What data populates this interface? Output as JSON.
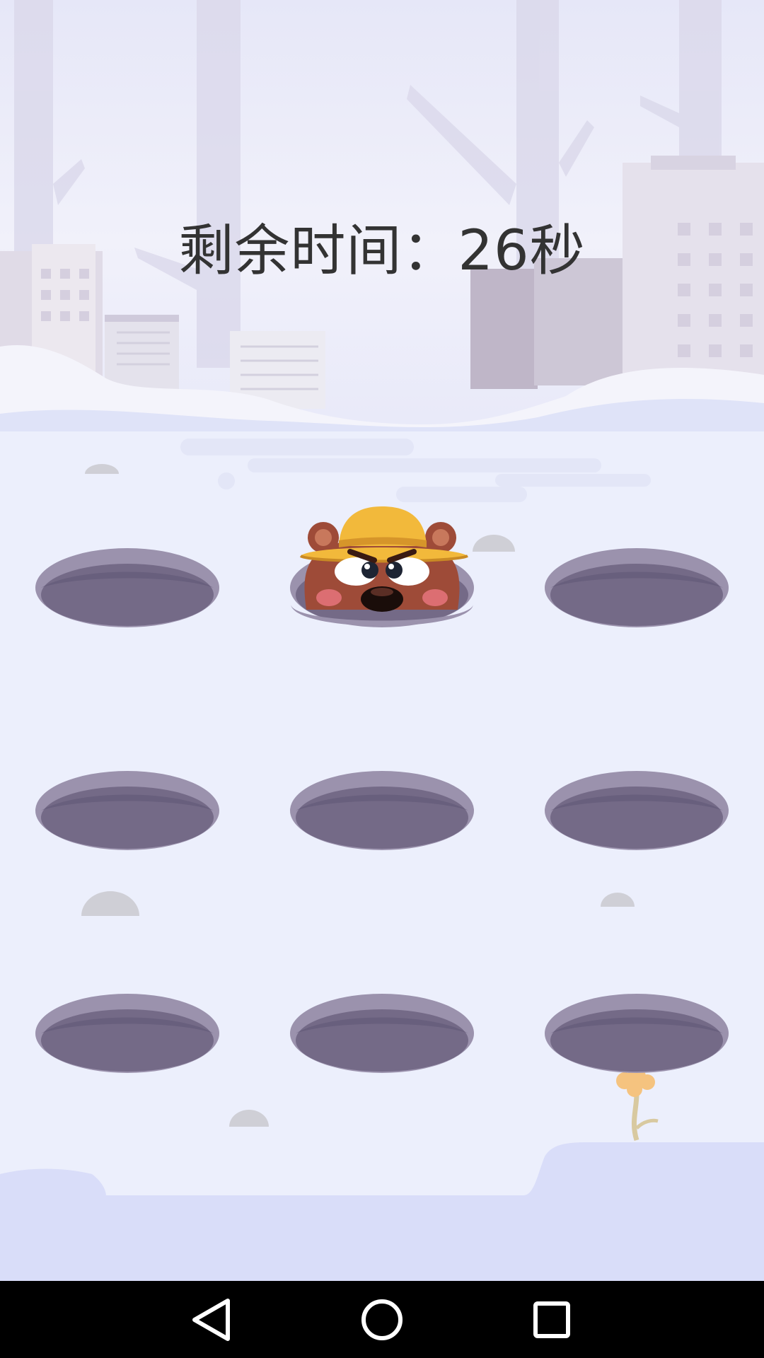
{
  "hud": {
    "timer_text": "剩余时间：26秒"
  },
  "game": {
    "grid_rows": 3,
    "grid_cols": 3,
    "holes": [
      {
        "id": 1,
        "occupied": false
      },
      {
        "id": 2,
        "occupied": true,
        "occupant": "bear-mole-with-yellow-hat"
      },
      {
        "id": 3,
        "occupied": false
      },
      {
        "id": 4,
        "occupied": false
      },
      {
        "id": 5,
        "occupied": false
      },
      {
        "id": 6,
        "occupied": false
      },
      {
        "id": 7,
        "occupied": false
      },
      {
        "id": 8,
        "occupied": false
      },
      {
        "id": 9,
        "occupied": false
      }
    ]
  },
  "navigation": {
    "buttons": [
      "back-icon",
      "home-icon",
      "recent-apps-icon"
    ]
  },
  "colors": {
    "background_snow": "#eef0fb",
    "hole_rim": "#9b92ad",
    "hole_inner": "#746a87",
    "mole_fur": "#9e4b38",
    "hat": "#f2b93b",
    "timer_text": "#333333"
  }
}
